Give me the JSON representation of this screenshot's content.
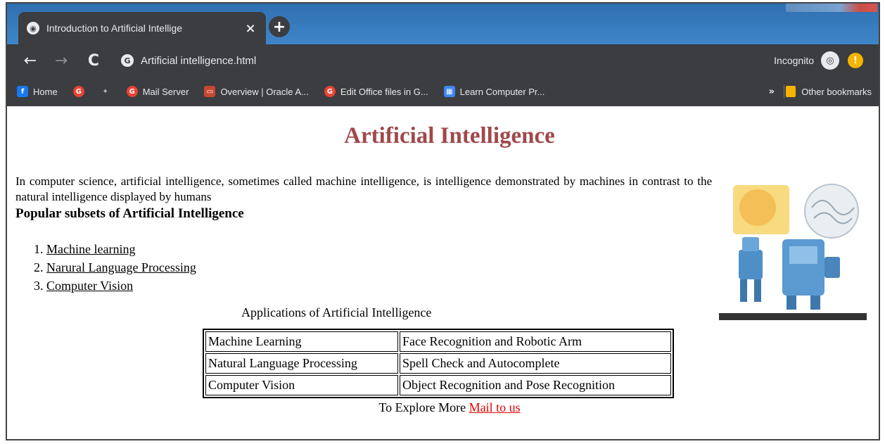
{
  "browser": {
    "tab_title": "Introduction to Artificial Intellige",
    "tab_close": "×",
    "new_tab": "+",
    "url": "Artificial intelligence.html",
    "incognito_label": "Incognito",
    "nav": {
      "back": "←",
      "forward": "→",
      "reload": "C"
    }
  },
  "bookmarks": {
    "items": [
      {
        "label": "Home",
        "icon": "facebook-icon",
        "color": "#1877f2"
      },
      {
        "label": "",
        "icon": "google-icon",
        "color": "#ea4335"
      },
      {
        "label": "",
        "icon": "pin-icon",
        "color": "#888888"
      },
      {
        "label": "Mail Server",
        "icon": "google-icon",
        "color": "#ea4335"
      },
      {
        "label": "Overview | Oracle A...",
        "icon": "oracle-icon",
        "color": "#c74634"
      },
      {
        "label": "Edit Office files in G...",
        "icon": "google-icon",
        "color": "#ea4335"
      },
      {
        "label": "Learn Computer Pr...",
        "icon": "grid-icon",
        "color": "#4285f4"
      }
    ],
    "more": "»",
    "other": "Other bookmarks"
  },
  "page": {
    "heading": "Artificial Intelligence",
    "intro": "In computer science, artificial intelligence, sometimes called machine intelligence, is intelligence demonstrated by machines in contrast to the natural intelligence displayed by humans",
    "subsets_title": "Popular subsets of Artificial Intelligence",
    "subsets": [
      {
        "num": "1.",
        "label": "Machine learning"
      },
      {
        "num": "2.",
        "label": "Narural Language Processing"
      },
      {
        "num": "3.",
        "label": "Computer Vision"
      }
    ],
    "table_caption": "Applications of Artificial Intelligence",
    "table_rows": [
      [
        "Machine Learning",
        "Face Recognition and Robotic Arm"
      ],
      [
        "Natural Language Processing",
        "Spell Check and Autocomplete"
      ],
      [
        "Computer Vision",
        "Object Recognition and Pose Recognition"
      ]
    ],
    "footer_text": "To Explore More",
    "footer_link": "Mail to us"
  },
  "colors": {
    "heading": "#a0484a",
    "link_mail": "#e00000",
    "toolbar": "#3b3d40",
    "tabstrip": "#3e86c9"
  }
}
